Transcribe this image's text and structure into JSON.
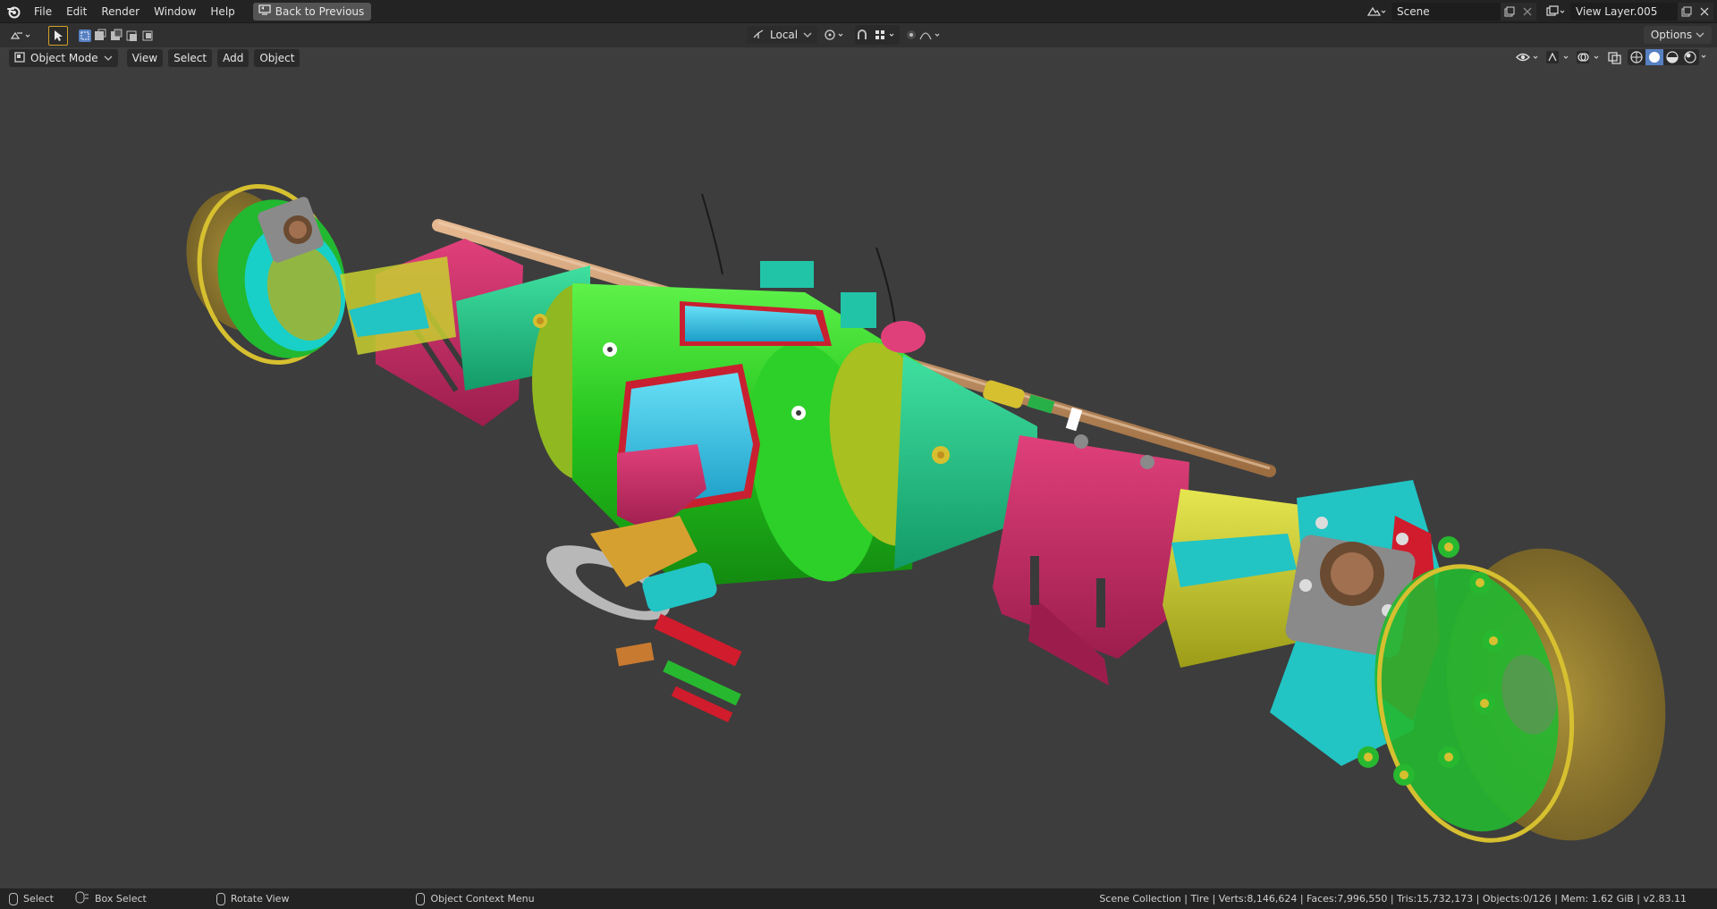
{
  "menubar": {
    "items": [
      "File",
      "Edit",
      "Render",
      "Window",
      "Help"
    ],
    "back_label": "Back to Previous"
  },
  "scene": {
    "label": "Scene"
  },
  "view_layer": {
    "label": "View Layer.005"
  },
  "tool_header": {
    "transform_orientation": "Local",
    "options_label": "Options"
  },
  "viewport_header": {
    "mode": "Object Mode",
    "menus": [
      "View",
      "Select",
      "Add",
      "Object"
    ]
  },
  "statusbar": {
    "hint_select": "Select",
    "hint_box_select": "Box Select",
    "hint_rotate": "Rotate View",
    "hint_context": "Object Context Menu",
    "info": "Scene Collection | Tire | Verts:8,146,624 | Faces:7,996,550 | Tris:15,732,173 | Objects:0/126 | Mem: 1.62 GiB | v2.83.11"
  },
  "colors": {
    "accent": "#5680c2",
    "menubar_bg": "#232323",
    "viewport_bg": "#3d3d3d"
  },
  "icons": [
    "blender-logo-icon",
    "back-icon",
    "cursor-icon",
    "select-box-icon",
    "scene-icon",
    "view-layer-icon",
    "mouse-icon"
  ]
}
